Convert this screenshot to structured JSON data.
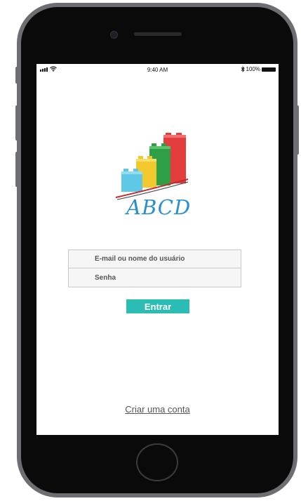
{
  "status_bar": {
    "time": "9:40 AM",
    "battery": "100%",
    "icons": [
      "signal-icon",
      "wifi-icon",
      "bluetooth-icon",
      "battery-icon"
    ]
  },
  "logo": {
    "text": "ABCD"
  },
  "login": {
    "email_placeholder": "E-mail ou nome do usuário",
    "password_placeholder": "Senha",
    "submit_label": "Entrar"
  },
  "signup_link": "Criar uma conta",
  "colors": {
    "accent": "#2bbcb3",
    "brick_blue": "#5ec8e6",
    "brick_yellow": "#f2c92c",
    "brick_green": "#2e9e47",
    "brick_red": "#e33d3d"
  }
}
